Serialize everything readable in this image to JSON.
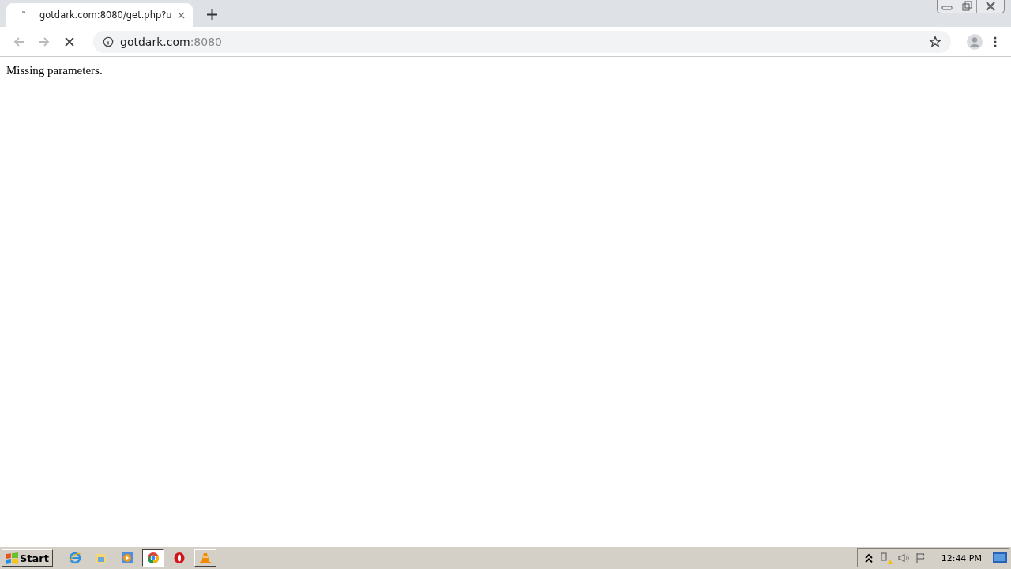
{
  "tab": {
    "title": "gotdark.com:8080/get.php?u",
    "loading": true
  },
  "address_bar": {
    "host": "gotdark.com",
    "port": ":8080"
  },
  "page": {
    "text": "Missing parameters."
  },
  "taskbar": {
    "start": "Start",
    "apps": [
      {
        "kind": "ie",
        "open": false,
        "selected": false
      },
      {
        "kind": "explorer",
        "open": false,
        "selected": false
      },
      {
        "kind": "media",
        "open": false,
        "selected": false
      },
      {
        "kind": "chrome",
        "open": true,
        "selected": true
      },
      {
        "kind": "opera",
        "open": false,
        "selected": false
      },
      {
        "kind": "vlc",
        "open": true,
        "selected": false
      }
    ],
    "clock": "12:44 PM"
  }
}
